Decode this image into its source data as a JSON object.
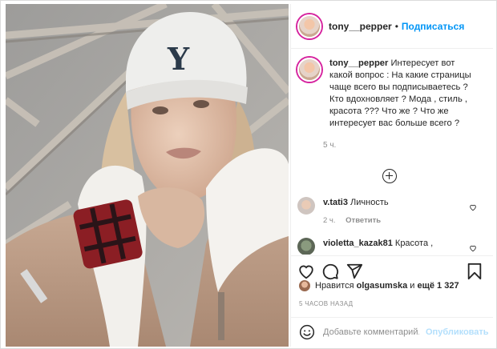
{
  "post": {
    "username": "tony__pepper",
    "dot": "•",
    "follow_label": "Подписаться"
  },
  "caption": {
    "username": "tony__pepper",
    "text": "Интересует вот какой вопрос : На какие страницы чаще всего вы подписываетесь ? Кто вдохновляет ? Мода , стиль , красота ??? Что же ? Что же интересует вас больше всего ?",
    "time": "5 ч."
  },
  "comments": [
    {
      "username": "v.tati3",
      "text": "Личность",
      "time": "2 ч.",
      "reply_label": "Ответить"
    },
    {
      "username": "violetta_kazak81",
      "text": "Красота ,"
    }
  ],
  "likes": {
    "prefix": "Нравится",
    "user": "olgasumska",
    "conj": "и",
    "more": "ещё 1 327"
  },
  "time_ago": "5 ЧАСОВ НАЗАД",
  "add_comment": {
    "placeholder": "Добавьте комментарий...",
    "publish_label": "Опубликовать"
  },
  "photo": {
    "hat_letter": "Y"
  },
  "colors": {
    "link": "#0095f6",
    "muted": "#8e8e8e",
    "publish_disabled": "#b3dffc",
    "border": "#efefef"
  },
  "icons": [
    "add-comment-icon",
    "heart-icon",
    "comment-icon",
    "share-icon",
    "bookmark-icon",
    "emoji-icon"
  ]
}
